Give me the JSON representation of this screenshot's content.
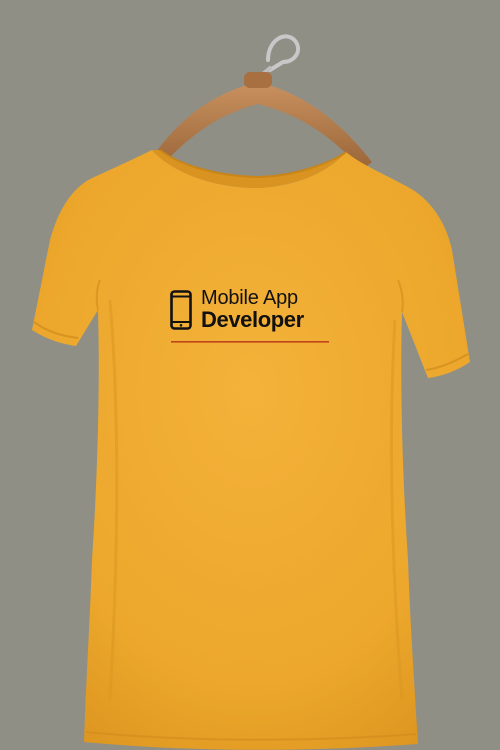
{
  "print": {
    "line1": "Mobile App",
    "line2": "Developer"
  },
  "icons": {
    "phone": "smartphone-icon",
    "hanger": "hanger-icon"
  },
  "colors": {
    "background": "#8f8f86",
    "shirt": "#f0ac2f",
    "shirt_shadow": "#d9931f",
    "print_text": "#111111",
    "underline": "#c0441a",
    "hanger": "#b07a4c"
  }
}
